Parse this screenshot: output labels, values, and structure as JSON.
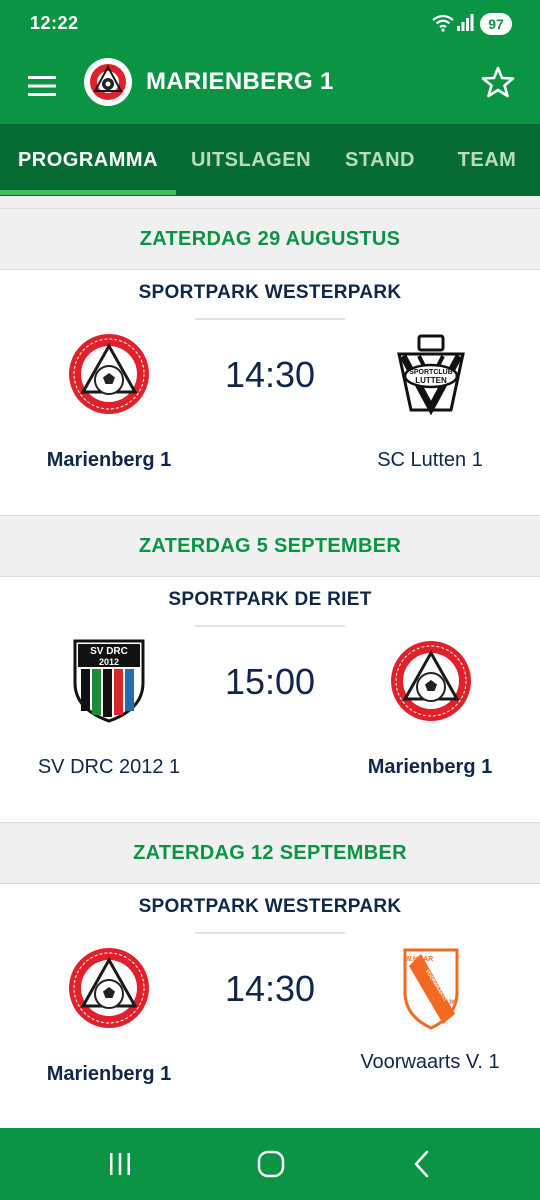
{
  "status_bar": {
    "time": "12:22",
    "battery": "97"
  },
  "header": {
    "title": "MARIENBERG 1",
    "menu_icon": "hamburger-icon",
    "favorite_icon": "star-icon"
  },
  "tabs": [
    {
      "label": "PROGRAMMA",
      "active": true
    },
    {
      "label": "UITSLAGEN",
      "active": false
    },
    {
      "label": "STAND",
      "active": false
    },
    {
      "label": "TEAM",
      "active": false
    }
  ],
  "matches": [
    {
      "date": "ZATERDAG 29 AUGUSTUS",
      "venue": "SPORTPARK WESTERPARK",
      "time": "14:30",
      "home": "Marienberg 1",
      "away": "SC Lutten 1",
      "home_logo": "marienberg-logo",
      "away_logo": "sc-lutten-logo"
    },
    {
      "date": "ZATERDAG 5 SEPTEMBER",
      "venue": "SPORTPARK DE RIET",
      "time": "15:00",
      "home": "SV DRC 2012 1",
      "away": "Marienberg 1",
      "home_logo": "sv-drc-logo",
      "away_logo": "marienberg-logo"
    },
    {
      "date": "ZATERDAG 12 SEPTEMBER",
      "venue": "SPORTPARK WESTERPARK",
      "time": "14:30",
      "home": "Marienberg 1",
      "away": "Voorwaarts V. 1",
      "home_logo": "marienberg-logo",
      "away_logo": "voorwaarts-logo"
    }
  ],
  "logos": {
    "drc_text_top": "SV DRC",
    "drc_text_year": "2012",
    "lutten_text": "SPORTCLUB",
    "lutten_text2": "LUTTEN",
    "voorwaarts_text1": "W.HAAR",
    "voorwaarts_text2": "VOORWAARTS",
    "voorwaarts_text3": "VR.WIJK"
  },
  "colors": {
    "primary": "#0b9444",
    "tabbar": "#076c33",
    "navy": "#10274a",
    "marienberg_red": "#e0202a",
    "voorwaarts_orange": "#f26a21"
  }
}
